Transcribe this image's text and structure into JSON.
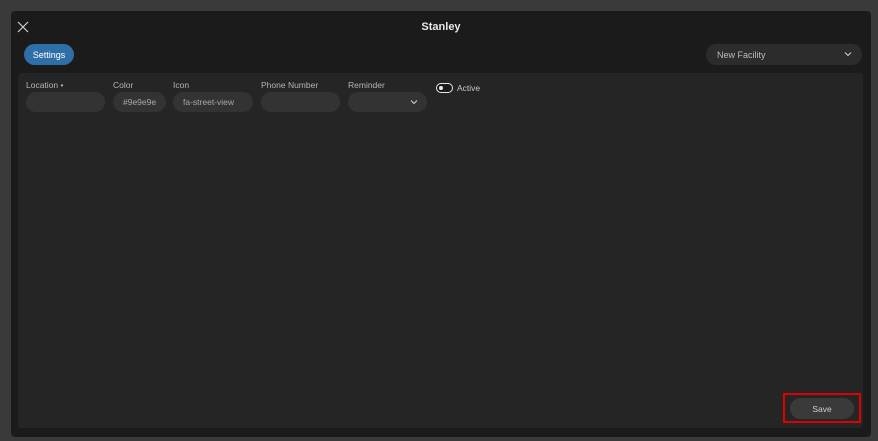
{
  "modal": {
    "title": "Stanley"
  },
  "tabs": [
    {
      "label": "Settings",
      "active": true
    }
  ],
  "facility_select": {
    "value": "New Facility"
  },
  "form": {
    "location": {
      "label": "Location •",
      "value": ""
    },
    "color": {
      "label": "Color",
      "value": "#9e9e9e"
    },
    "icon": {
      "label": "Icon",
      "value": "fa-street-view"
    },
    "phone": {
      "label": "Phone Number",
      "value": ""
    },
    "reminder": {
      "label": "Reminder",
      "value": ""
    },
    "active": {
      "label": "Active",
      "checked": true
    }
  },
  "footer": {
    "save_label": "Save"
  },
  "colors": {
    "accent": "#2e6fa8",
    "highlight": "#e00000",
    "modal_bg": "#1b1b1b",
    "panel_bg": "#252525"
  }
}
